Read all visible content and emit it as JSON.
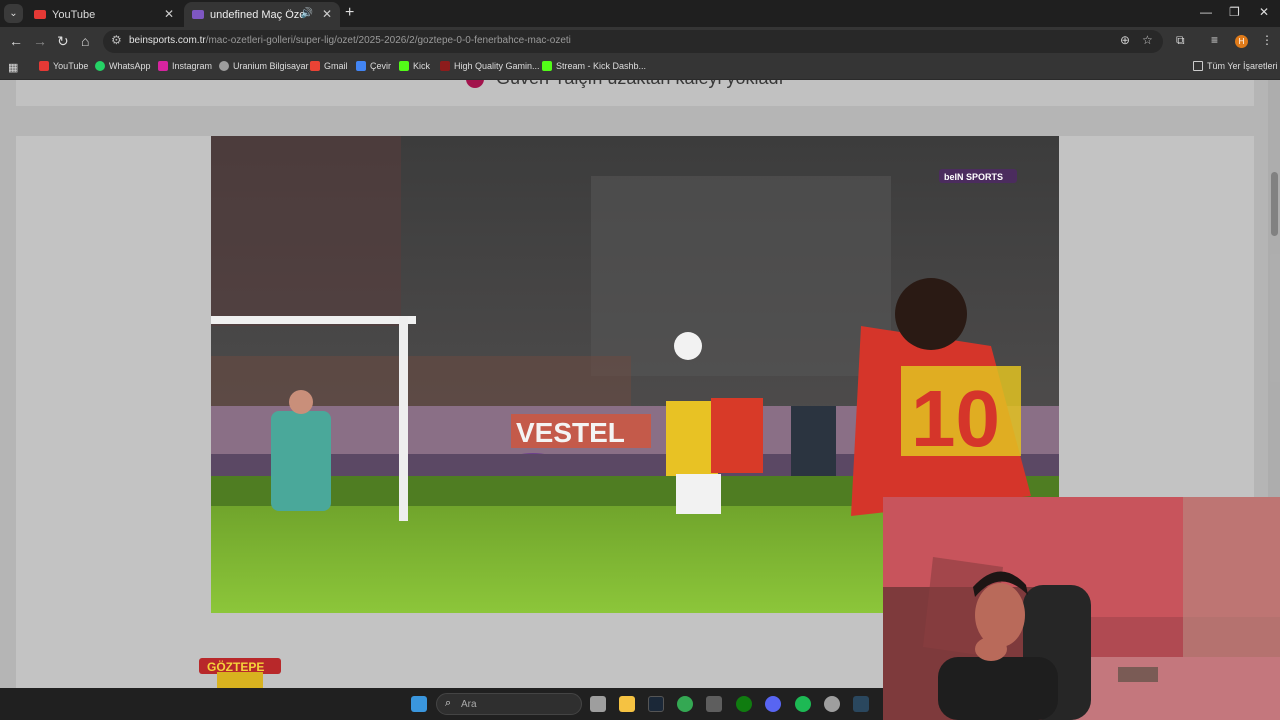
{
  "tabs": [
    {
      "title": "YouTube",
      "favicon_color": "#e53935",
      "active": false
    },
    {
      "title": "undefined Maç Özeti (Video",
      "favicon_color": "#7e57c2",
      "active": true
    }
  ],
  "icons": {
    "tab_list": "chevron-down-icon",
    "tab_close": "close-icon",
    "audio": "speaker-icon",
    "new_tab": "plus-icon",
    "minimize": "minimize-icon",
    "restore": "restore-icon",
    "window_close": "close-icon",
    "back": "arrow-left-icon",
    "forward": "arrow-right-icon",
    "reload": "reload-icon",
    "home": "home-icon",
    "site_info": "tune-icon",
    "zoom": "zoom-icon",
    "star": "star-icon",
    "extensions": "puzzle-icon",
    "media": "media-control-icon",
    "menu": "kebab-menu-icon",
    "apps": "apps-grid-icon",
    "folder": "folder-icon"
  },
  "window_controls": {
    "minimize": "—",
    "restore": "❐",
    "close": "✕"
  },
  "address": {
    "domain": "beinsports.com.tr",
    "path": "/mac-ozetleri-golleri/super-lig/ozet/2025-2026/2/goztepe-0-0-fenerbahce-mac-ozeti"
  },
  "profile_initial": "H",
  "bookmarks": [
    {
      "label": "YouTube",
      "color": "#e53935"
    },
    {
      "label": "WhatsApp",
      "color": "#25d366"
    },
    {
      "label": "Instagram",
      "color": "#d6249f"
    },
    {
      "label": "Uranium Bilgisayar",
      "color": "#9e9e9e"
    },
    {
      "label": "Gmail",
      "color": "#ea4335"
    },
    {
      "label": "Çevir",
      "color": "#4285f4"
    },
    {
      "label": "Kick",
      "color": "#53fc18"
    },
    {
      "label": "High Quality Gamin...",
      "color": "#8d1c1c"
    },
    {
      "label": "Stream - Kick Dashb...",
      "color": "#53fc18"
    }
  ],
  "all_bookmarks": "Tüm Yer İşaretleri",
  "page": {
    "headline": "Güven Yalçın uzaktan kaleyi yokladı",
    "broadcaster": "beIN SPORTS",
    "ad_board": "VESTEL",
    "player_number": "10",
    "team_logo_text": "GÖZTEPE"
  },
  "taskbar": {
    "search_placeholder": "Ara",
    "apps": [
      {
        "name": "windows-start-icon",
        "color": "#3a96dd"
      },
      {
        "name": "task-view-icon",
        "color": "#9e9e9e"
      },
      {
        "name": "file-explorer-icon",
        "color": "#f5c242"
      },
      {
        "name": "steam-icon",
        "color": "#1b2838"
      },
      {
        "name": "chrome-icon",
        "color": "#34a853"
      },
      {
        "name": "store-icon",
        "color": "#5e5e5e"
      },
      {
        "name": "xbox-icon",
        "color": "#107c10"
      },
      {
        "name": "discord-icon",
        "color": "#5865f2"
      },
      {
        "name": "spotify-icon",
        "color": "#1db954"
      },
      {
        "name": "obs-icon",
        "color": "#9e9e9e"
      },
      {
        "name": "steam-icon",
        "color": "#2a475e"
      }
    ]
  }
}
